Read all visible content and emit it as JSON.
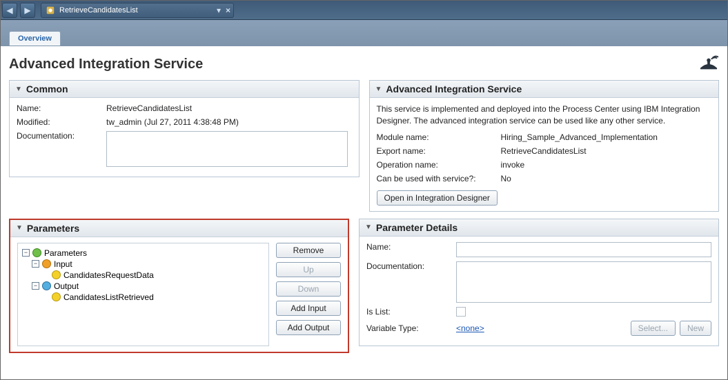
{
  "titlebar": {
    "title": "RetrieveCandidatesList"
  },
  "subtab": {
    "label": "Overview"
  },
  "page": {
    "heading": "Advanced Integration Service"
  },
  "common": {
    "section_title": "Common",
    "name_label": "Name:",
    "name_value": "RetrieveCandidatesList",
    "modified_label": "Modified:",
    "modified_value": "tw_admin (Jul 27, 2011 4:38:48 PM)",
    "doc_label": "Documentation:",
    "doc_value": ""
  },
  "ais": {
    "section_title": "Advanced Integration Service",
    "description": "This service is implemented and deployed into the Process Center using IBM Integration Designer. The advanced integration service can be used like any other service.",
    "module_label": "Module name:",
    "module_value": "Hiring_Sample_Advanced_Implementation",
    "export_label": "Export name:",
    "export_value": "RetrieveCandidatesList",
    "operation_label": "Operation name:",
    "operation_value": "invoke",
    "can_use_label": "Can be used with service?:",
    "can_use_value": "No",
    "open_button": "Open in Integration Designer"
  },
  "parameters": {
    "section_title": "Parameters",
    "tree": {
      "root": "Parameters",
      "input_label": "Input",
      "input_items": [
        "CandidatesRequestData"
      ],
      "output_label": "Output",
      "output_items": [
        "CandidatesListRetrieved"
      ]
    },
    "buttons": {
      "remove": "Remove",
      "up": "Up",
      "down": "Down",
      "add_input": "Add Input",
      "add_output": "Add Output"
    }
  },
  "param_details": {
    "section_title": "Parameter Details",
    "name_label": "Name:",
    "name_value": "",
    "doc_label": "Documentation:",
    "doc_value": "",
    "islist_label": "Is List:",
    "vartype_label": "Variable Type:",
    "vartype_value": "<none>",
    "select_btn": "Select...",
    "new_btn": "New"
  }
}
